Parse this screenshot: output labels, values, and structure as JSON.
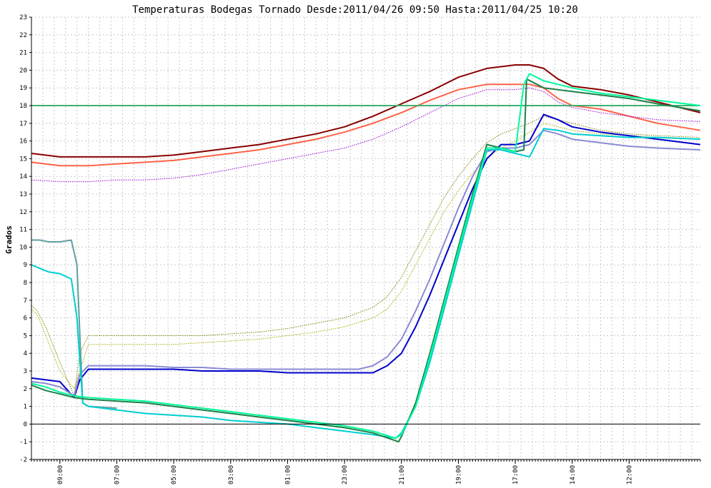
{
  "chart_data": {
    "type": "line",
    "title": "Temperaturas Bodegas Tornado Desde:2011/04/26 09:50 Hasta:2011/04/25 10:20",
    "xlabel": "",
    "ylabel": "Grados",
    "ylim": [
      -2,
      23
    ],
    "yticks": [
      -2,
      -1,
      0,
      1,
      2,
      3,
      4,
      5,
      6,
      7,
      8,
      9,
      10,
      11,
      12,
      13,
      14,
      15,
      16,
      17,
      18,
      19,
      20,
      21,
      22,
      23
    ],
    "xlim": [
      0,
      235
    ],
    "xticks": [
      {
        "pos": 10,
        "label": "09:00"
      },
      {
        "pos": 30,
        "label": "07:00"
      },
      {
        "pos": 50,
        "label": "05:00"
      },
      {
        "pos": 70,
        "label": "03:00"
      },
      {
        "pos": 90,
        "label": "01:00"
      },
      {
        "pos": 110,
        "label": "23:00"
      },
      {
        "pos": 130,
        "label": "21:00"
      },
      {
        "pos": 150,
        "label": "19:00"
      },
      {
        "pos": 170,
        "label": "17:00"
      },
      {
        "pos": 190,
        "label": "14:00"
      },
      {
        "pos": 210,
        "label": "12:00"
      }
    ],
    "grid": true,
    "zero_line": true,
    "series": [
      {
        "color": "#8b0000",
        "dash": false,
        "width": 2,
        "x": [
          0,
          10,
          20,
          30,
          40,
          50,
          60,
          70,
          80,
          90,
          100,
          110,
          120,
          130,
          140,
          150,
          160,
          170,
          175,
          180,
          185,
          190,
          200,
          210,
          220,
          235
        ],
        "y": [
          15.3,
          15.1,
          15.1,
          15.1,
          15.1,
          15.2,
          15.4,
          15.6,
          15.8,
          16.1,
          16.4,
          16.8,
          17.4,
          18.1,
          18.8,
          19.6,
          20.1,
          20.3,
          20.3,
          20.1,
          19.5,
          19.1,
          18.9,
          18.6,
          18.2,
          17.6
        ]
      },
      {
        "color": "#ff6347",
        "dash": false,
        "width": 2,
        "x": [
          0,
          10,
          20,
          30,
          40,
          50,
          60,
          70,
          80,
          90,
          100,
          110,
          120,
          130,
          140,
          150,
          160,
          170,
          175,
          180,
          185,
          190,
          200,
          210,
          220,
          235
        ],
        "y": [
          14.8,
          14.6,
          14.6,
          14.7,
          14.8,
          14.9,
          15.1,
          15.3,
          15.5,
          15.8,
          16.1,
          16.5,
          17.0,
          17.6,
          18.3,
          18.9,
          19.2,
          19.2,
          19.2,
          19.0,
          18.4,
          18.0,
          17.8,
          17.4,
          17.0,
          16.6
        ]
      },
      {
        "color": "#9400d3",
        "dash": true,
        "width": 1,
        "x": [
          0,
          10,
          20,
          30,
          40,
          50,
          60,
          70,
          80,
          90,
          100,
          110,
          120,
          130,
          140,
          150,
          160,
          170,
          175,
          180,
          185,
          190,
          200,
          210,
          220,
          235
        ],
        "y": [
          13.8,
          13.7,
          13.7,
          13.8,
          13.8,
          13.9,
          14.1,
          14.4,
          14.7,
          15.0,
          15.3,
          15.6,
          16.1,
          16.8,
          17.6,
          18.4,
          18.9,
          18.9,
          19.0,
          18.8,
          18.2,
          17.9,
          17.6,
          17.4,
          17.2,
          17.1
        ]
      },
      {
        "color": "#3cb371",
        "dash": false,
        "width": 2,
        "x": [
          0,
          10,
          15,
          20,
          40,
          60,
          80,
          100,
          110,
          120,
          126,
          128,
          130,
          136,
          140,
          150,
          160,
          163,
          166,
          170,
          175,
          180,
          181,
          185,
          190,
          200,
          210,
          220,
          235
        ],
        "y": [
          18.0,
          18.0,
          18.0,
          18.0,
          18.0,
          18.0,
          18.0,
          18.0,
          18.0,
          18.0,
          18.0,
          18.0,
          18.0,
          18.0,
          18.0,
          18.0,
          18.0,
          18.0,
          18.0,
          18.0,
          18.0,
          18.0,
          18.0,
          18.0,
          18.0,
          18.0,
          18.0,
          18.0,
          18.0
        ]
      },
      {
        "color": "#aaaa00",
        "dash": true,
        "width": 1,
        "x": [
          0,
          2,
          5,
          10,
          15,
          18,
          20,
          30,
          40,
          50,
          60,
          70,
          80,
          90,
          100,
          110,
          120,
          125,
          130,
          135,
          140,
          145,
          150,
          155,
          160,
          165,
          170,
          175,
          180,
          185,
          190,
          200,
          210,
          220,
          235
        ],
        "y": [
          6.5,
          6.2,
          5.0,
          3.0,
          2.0,
          3.5,
          4.5,
          4.5,
          4.5,
          4.5,
          4.6,
          4.7,
          4.8,
          5.0,
          5.2,
          5.5,
          6.0,
          6.5,
          7.5,
          9.0,
          10.5,
          12.0,
          13.2,
          14.2,
          15.0,
          15.6,
          16.0,
          16.5,
          17.0,
          16.8,
          16.6,
          16.4,
          16.3,
          16.2,
          16.1
        ]
      },
      {
        "color": "#808000",
        "dash": true,
        "width": 1,
        "x": [
          0,
          2,
          5,
          10,
          15,
          17,
          20,
          30,
          40,
          50,
          60,
          70,
          80,
          90,
          100,
          110,
          120,
          125,
          130,
          135,
          140,
          145,
          150,
          155,
          160,
          165,
          170,
          175,
          180,
          185,
          190,
          200,
          210,
          220,
          235
        ],
        "y": [
          6.7,
          6.4,
          5.5,
          3.5,
          1.6,
          4.0,
          5.0,
          5.0,
          5.0,
          5.0,
          5.0,
          5.1,
          5.2,
          5.4,
          5.7,
          6.0,
          6.6,
          7.2,
          8.3,
          9.8,
          11.3,
          12.8,
          14.0,
          15.0,
          15.9,
          16.4,
          16.7,
          17.0,
          17.4,
          17.2,
          17.0,
          16.6,
          16.4,
          16.3,
          16.2
        ]
      },
      {
        "color": "#0000cd",
        "dash": false,
        "width": 2,
        "x": [
          0,
          5,
          10,
          15,
          17,
          20,
          30,
          40,
          50,
          60,
          70,
          80,
          90,
          100,
          110,
          115,
          120,
          125,
          130,
          135,
          140,
          145,
          150,
          155,
          160,
          165,
          170,
          175,
          180,
          185,
          190,
          200,
          210,
          220,
          235
        ],
        "y": [
          2.6,
          2.5,
          2.4,
          1.5,
          2.5,
          3.1,
          3.1,
          3.1,
          3.1,
          3.0,
          3.0,
          3.0,
          2.9,
          2.9,
          2.9,
          2.9,
          2.9,
          3.3,
          4.0,
          5.5,
          7.3,
          9.3,
          11.3,
          13.3,
          15.0,
          15.8,
          15.8,
          16.0,
          17.5,
          17.2,
          16.8,
          16.5,
          16.3,
          16.1,
          15.8
        ]
      },
      {
        "color": "#8a8ad6",
        "dash": false,
        "width": 2,
        "x": [
          0,
          5,
          10,
          15,
          17,
          20,
          30,
          40,
          50,
          60,
          70,
          80,
          90,
          100,
          110,
          115,
          120,
          125,
          130,
          135,
          140,
          145,
          150,
          155,
          160,
          165,
          170,
          175,
          180,
          185,
          190,
          200,
          210,
          220,
          235
        ],
        "y": [
          2.4,
          2.3,
          2.1,
          1.6,
          2.8,
          3.3,
          3.3,
          3.3,
          3.2,
          3.2,
          3.1,
          3.1,
          3.1,
          3.1,
          3.1,
          3.1,
          3.3,
          3.8,
          4.8,
          6.4,
          8.2,
          10.2,
          12.2,
          14.0,
          15.4,
          15.6,
          15.6,
          15.8,
          16.6,
          16.4,
          16.1,
          15.9,
          15.7,
          15.6,
          15.5
        ]
      },
      {
        "color": "#5f9ea0",
        "dash": false,
        "width": 2,
        "x": [
          0,
          3,
          6,
          10,
          14,
          16,
          18,
          20,
          30
        ],
        "y": [
          10.4,
          10.4,
          10.3,
          10.3,
          10.4,
          9.0,
          1.2,
          1.0,
          0.9
        ]
      },
      {
        "color": "#00ced1",
        "dash": false,
        "width": 2,
        "x": [
          0,
          3,
          6,
          10,
          14,
          16,
          18,
          20,
          30,
          40,
          50,
          60,
          70,
          80,
          90,
          100,
          110,
          120,
          128,
          130,
          135,
          140,
          145,
          150,
          155,
          160,
          165,
          170,
          175,
          180,
          185,
          190,
          200,
          210,
          220,
          235
        ],
        "y": [
          9.0,
          8.8,
          8.6,
          8.5,
          8.2,
          6.0,
          1.2,
          1.0,
          0.8,
          0.6,
          0.5,
          0.4,
          0.2,
          0.1,
          0.0,
          -0.2,
          -0.4,
          -0.6,
          -0.8,
          -0.5,
          1.0,
          3.5,
          6.5,
          9.5,
          12.5,
          15.5,
          15.5,
          15.3,
          15.1,
          16.7,
          16.6,
          16.4,
          16.3,
          16.2,
          16.2,
          16.1
        ]
      },
      {
        "color": "#1e7f4a",
        "dash": false,
        "width": 2,
        "x": [
          0,
          5,
          10,
          15,
          20,
          30,
          40,
          50,
          60,
          70,
          80,
          90,
          100,
          110,
          120,
          129,
          130,
          135,
          140,
          145,
          150,
          155,
          160,
          165,
          170,
          173,
          174,
          180,
          190,
          200,
          210,
          220,
          235
        ],
        "y": [
          2.2,
          1.9,
          1.7,
          1.5,
          1.4,
          1.3,
          1.2,
          1.0,
          0.8,
          0.6,
          0.4,
          0.2,
          0.0,
          -0.2,
          -0.5,
          -1.0,
          -0.7,
          1.2,
          4.0,
          7.0,
          10.0,
          13.0,
          15.8,
          15.6,
          15.4,
          15.5,
          19.5,
          19.0,
          18.8,
          18.6,
          18.4,
          18.1,
          17.7
        ]
      },
      {
        "color": "#00fa9a",
        "dash": false,
        "width": 2,
        "x": [
          0,
          5,
          10,
          15,
          20,
          30,
          40,
          50,
          60,
          70,
          80,
          90,
          100,
          110,
          120,
          128,
          130,
          135,
          140,
          145,
          150,
          155,
          160,
          165,
          170,
          173,
          175,
          180,
          190,
          200,
          210,
          220,
          235
        ],
        "y": [
          2.3,
          2.1,
          1.8,
          1.6,
          1.5,
          1.4,
          1.3,
          1.1,
          0.9,
          0.7,
          0.5,
          0.3,
          0.1,
          -0.1,
          -0.4,
          -0.8,
          -0.6,
          1.0,
          3.8,
          6.8,
          9.8,
          12.8,
          15.6,
          15.6,
          15.4,
          19.2,
          19.8,
          19.4,
          19.0,
          18.7,
          18.5,
          18.3,
          18.0
        ]
      }
    ]
  }
}
